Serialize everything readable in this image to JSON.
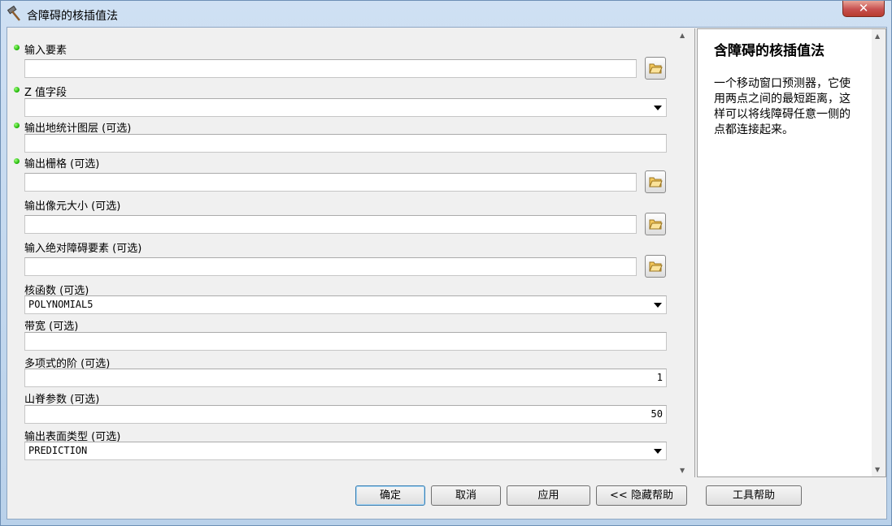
{
  "window": {
    "title": "含障碍的核插值法",
    "close": "✕"
  },
  "params": {
    "input_features_label": "输入要素",
    "input_features_value": "",
    "z_field_label": "Z 值字段",
    "z_field_value": "",
    "out_geo_layer_label": "输出地统计图层 (可选)",
    "out_geo_layer_value": "",
    "out_raster_label": "输出栅格 (可选)",
    "out_raster_value": "",
    "cell_size_label": "输出像元大小 (可选)",
    "cell_size_value": "",
    "barriers_label": "输入绝对障碍要素 (可选)",
    "barriers_value": "",
    "kernel_label": "核函数 (可选)",
    "kernel_value": "POLYNOMIAL5",
    "bandwidth_label": "带宽 (可选)",
    "bandwidth_value": "",
    "order_label": "多项式的阶 (可选)",
    "order_value": "1",
    "ridge_label": "山脊参数 (可选)",
    "ridge_value": "50",
    "surface_type_label": "输出表面类型 (可选)",
    "surface_type_value": "PREDICTION"
  },
  "help": {
    "title": "含障碍的核插值法",
    "body": "一个移动窗口预测器，它使用两点之间的最短距离，这样可以将线障碍任意一侧的点都连接起来。"
  },
  "buttons": {
    "ok": "确定",
    "cancel": "取消",
    "apply": "应用",
    "hide_help": "<< 隐藏帮助",
    "tool_help": "工具帮助"
  },
  "colors": {
    "required_dot": "#18b000",
    "title_bar": "#b9d1ea"
  }
}
